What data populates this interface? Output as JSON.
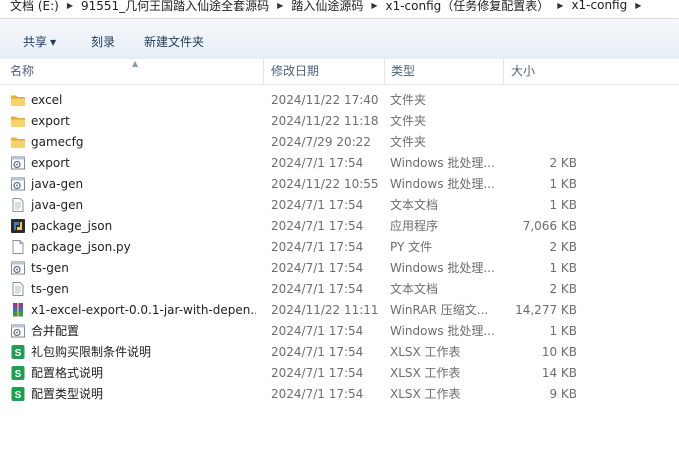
{
  "breadcrumb": [
    "文档 (E:)",
    "91551_几何王国踏入仙途全套源码",
    "踏入仙途源码",
    "x1-config（任务修复配置表）",
    "x1-config"
  ],
  "toolbar": {
    "share_label": "共享",
    "burn_label": "刻录",
    "new_folder_label": "新建文件夹"
  },
  "columns": {
    "name": "名称",
    "date": "修改日期",
    "type": "类型",
    "size": "大小"
  },
  "files": [
    {
      "icon": "folder-icon",
      "name": "excel",
      "date": "2024/11/22 17:40",
      "type": "文件夹",
      "size": ""
    },
    {
      "icon": "folder-icon",
      "name": "export",
      "date": "2024/11/22 11:18",
      "type": "文件夹",
      "size": ""
    },
    {
      "icon": "folder-icon",
      "name": "gamecfg",
      "date": "2024/7/29 20:22",
      "type": "文件夹",
      "size": ""
    },
    {
      "icon": "batch-file-icon",
      "name": "export",
      "date": "2024/7/1 17:54",
      "type": "Windows 批处理...",
      "size": "2 KB"
    },
    {
      "icon": "batch-file-icon",
      "name": "java-gen",
      "date": "2024/11/22 10:55",
      "type": "Windows 批处理...",
      "size": "1 KB"
    },
    {
      "icon": "text-file-icon",
      "name": "java-gen",
      "date": "2024/7/1 17:54",
      "type": "文本文档",
      "size": "1 KB"
    },
    {
      "icon": "python-exe-icon",
      "name": "package_json",
      "date": "2024/7/1 17:54",
      "type": "应用程序",
      "size": "7,066 KB"
    },
    {
      "icon": "blank-file-icon",
      "name": "package_json.py",
      "date": "2024/7/1 17:54",
      "type": "PY 文件",
      "size": "2 KB"
    },
    {
      "icon": "batch-file-icon",
      "name": "ts-gen",
      "date": "2024/7/1 17:54",
      "type": "Windows 批处理...",
      "size": "1 KB"
    },
    {
      "icon": "text-file-icon",
      "name": "ts-gen",
      "date": "2024/7/1 17:54",
      "type": "文本文档",
      "size": "2 KB"
    },
    {
      "icon": "winrar-archive-icon",
      "name": "x1-excel-export-0.0.1-jar-with-depen...",
      "date": "2024/11/22 11:11",
      "type": "WinRAR 压缩文...",
      "size": "14,277 KB"
    },
    {
      "icon": "batch-file-icon",
      "name": "合并配置",
      "date": "2024/7/1 17:54",
      "type": "Windows 批处理...",
      "size": "1 KB"
    },
    {
      "icon": "xlsx-file-icon",
      "name": "礼包购买限制条件说明",
      "date": "2024/7/1 17:54",
      "type": "XLSX 工作表",
      "size": "10 KB"
    },
    {
      "icon": "xlsx-file-icon",
      "name": "配置格式说明",
      "date": "2024/7/1 17:54",
      "type": "XLSX 工作表",
      "size": "14 KB"
    },
    {
      "icon": "xlsx-file-icon",
      "name": "配置类型说明",
      "date": "2024/7/1 17:54",
      "type": "XLSX 工作表",
      "size": "9 KB"
    }
  ]
}
